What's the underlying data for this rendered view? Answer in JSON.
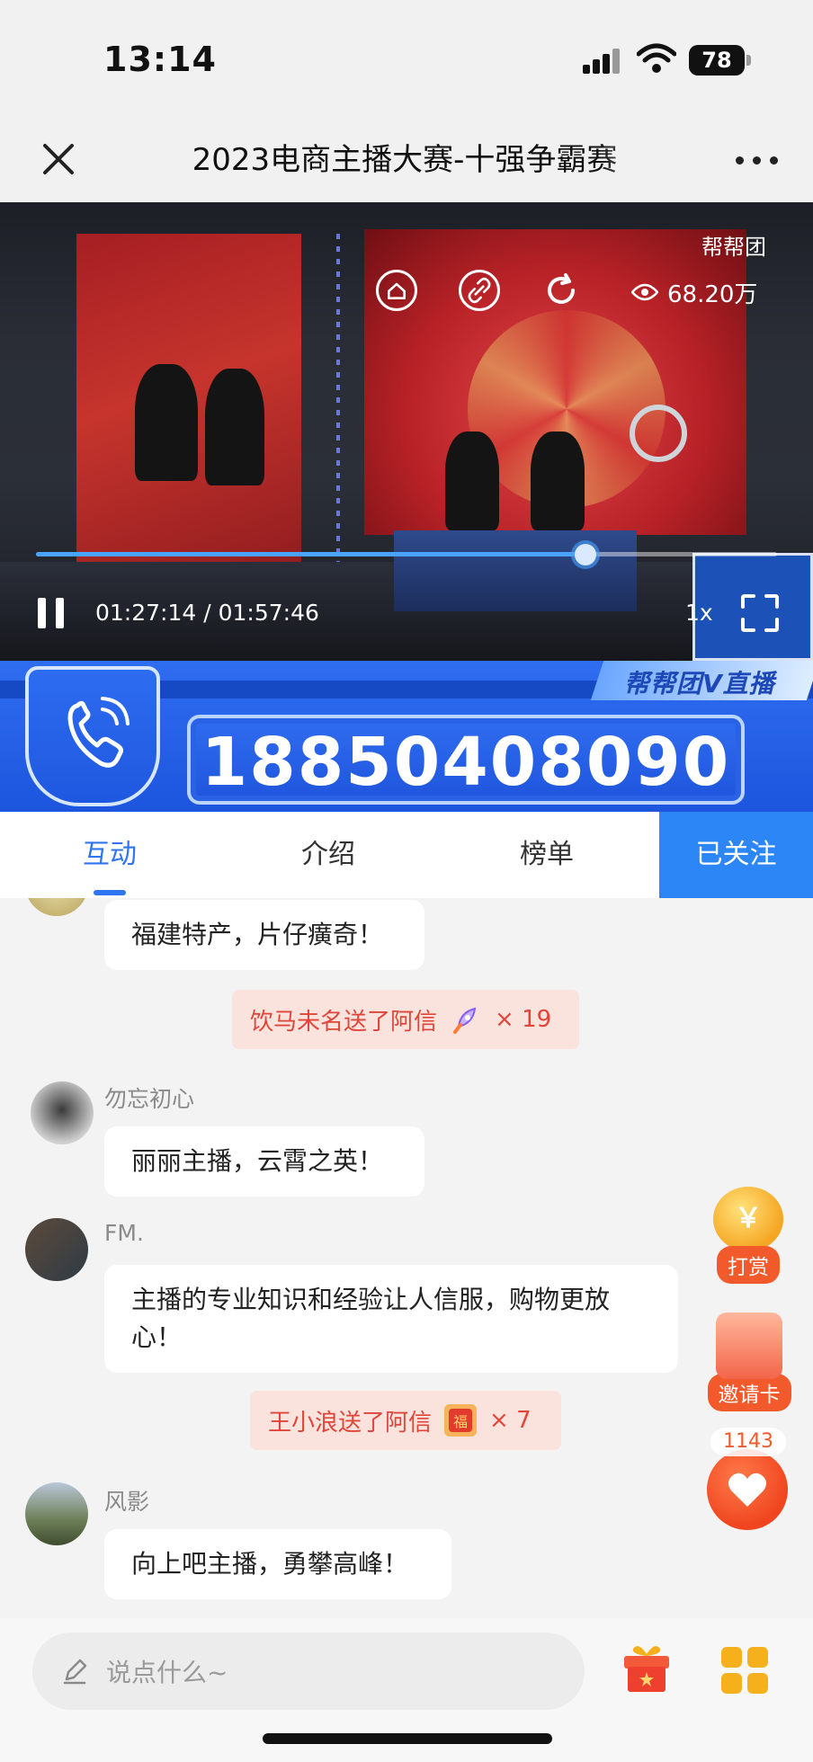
{
  "status_bar": {
    "time": "13:14",
    "battery": "78"
  },
  "nav": {
    "title": "2023电商主播大赛-十强争霸赛"
  },
  "video": {
    "watermark": "帮帮团",
    "viewers": "68.20万",
    "position": "01:27:14",
    "duration": "01:57:46",
    "progress": 0.741,
    "speed": "1x"
  },
  "banner": {
    "tag": "帮帮团V直播",
    "phone_number": "18850408090",
    "colors": {
      "primary": "#1d55de",
      "accent": "#b9d4ff"
    }
  },
  "tabs": {
    "items": [
      {
        "label": "互动",
        "active": true
      },
      {
        "label": "介绍",
        "active": false
      },
      {
        "label": "榜单",
        "active": false
      }
    ],
    "follow_label": "已关注"
  },
  "chat": {
    "top_message": "福建特产，片仔癀奇！",
    "gift1": {
      "text": "饮马未名送了阿信",
      "count": "× 19",
      "icon": "rocket-icon"
    },
    "msg1": {
      "user": "勿忘初心",
      "text": "丽丽主播，云霄之英！"
    },
    "msg2": {
      "user": "FM.",
      "text": "主播的专业知识和经验让人信服，购物更放心！"
    },
    "gift2": {
      "text": "王小浪送了阿信",
      "count": "× 7",
      "icon": "fu-card-icon"
    },
    "msg3": {
      "user": "风影",
      "text": "向上吧主播，勇攀高峰！"
    }
  },
  "float_buttons": {
    "reward_label": "打赏",
    "coin_symbol": "￥",
    "invite_label": "邀请卡",
    "like_count": "1143"
  },
  "bottom_bar": {
    "placeholder": "说点什么~"
  }
}
